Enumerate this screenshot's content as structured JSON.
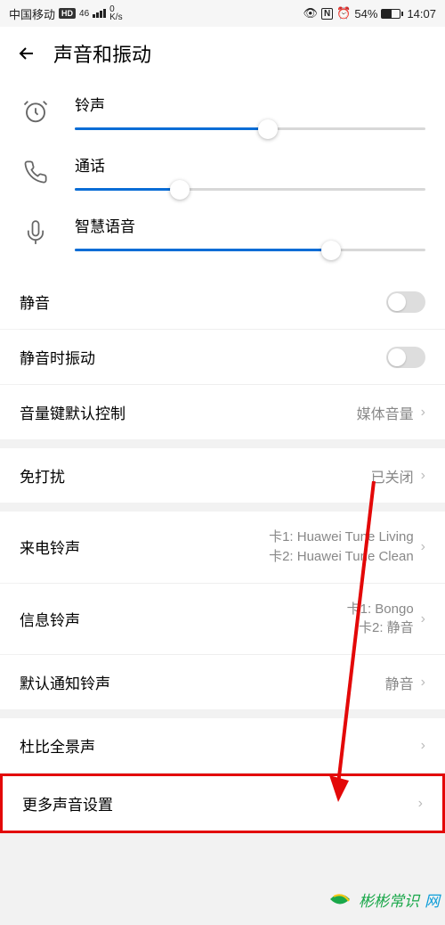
{
  "status_bar": {
    "carrier": "中国移动",
    "hd": "HD",
    "net_type": "46",
    "speed_top": "0",
    "speed_bot": "K/s",
    "nfc": "N",
    "battery_pct": "54%",
    "time": "14:07"
  },
  "header": {
    "title": "声音和振动"
  },
  "sliders": {
    "ringtone": {
      "label": "铃声",
      "value": 55
    },
    "call": {
      "label": "通话",
      "value": 30
    },
    "voice": {
      "label": "智慧语音",
      "value": 73
    }
  },
  "rows": {
    "mute": {
      "label": "静音",
      "enabled": false
    },
    "vibrate_on_mute": {
      "label": "静音时振动",
      "enabled": false
    },
    "volume_key": {
      "label": "音量键默认控制",
      "value": "媒体音量"
    },
    "dnd": {
      "label": "免打扰",
      "value": "已关闭"
    },
    "ringtone_call": {
      "label": "来电铃声",
      "value1": "卡1: Huawei Tune Living",
      "value2": "卡2: Huawei Tune Clean"
    },
    "ringtone_msg": {
      "label": "信息铃声",
      "value1": "卡1: Bongo",
      "value2": "卡2: 静音"
    },
    "ringtone_default": {
      "label": "默认通知铃声",
      "value": "静音"
    },
    "dolby": {
      "label": "杜比全景声"
    },
    "more": {
      "label": "更多声音设置"
    }
  },
  "watermark": {
    "text": "彬彬常识",
    "suffix": "网"
  }
}
